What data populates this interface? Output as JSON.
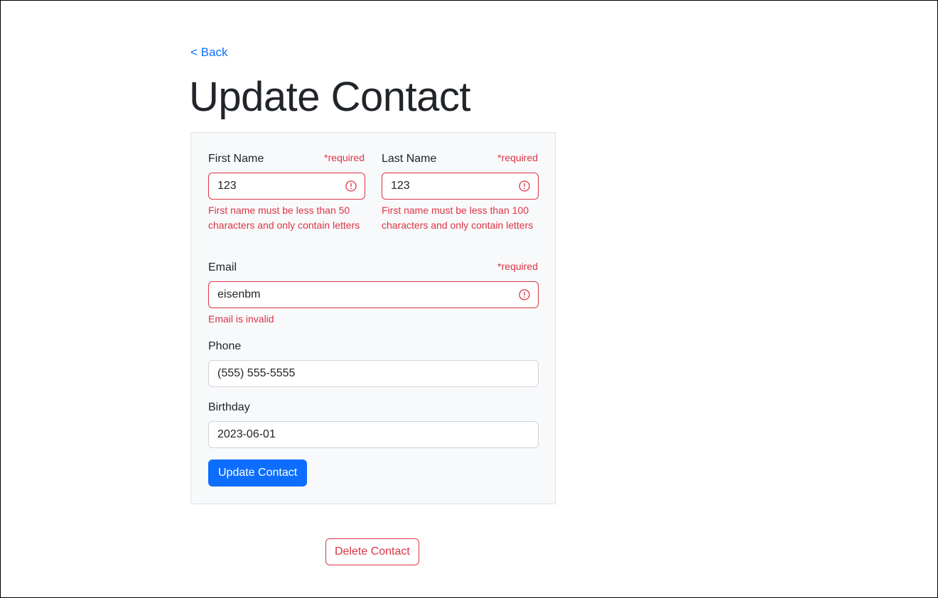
{
  "nav": {
    "back_label": "< Back"
  },
  "page": {
    "title": "Update Contact"
  },
  "form": {
    "required_marker": "*required",
    "first_name": {
      "label": "First Name",
      "value": "123",
      "error": "First name must be less than 50 characters and only contain letters"
    },
    "last_name": {
      "label": "Last Name",
      "value": "123",
      "error": "First name must be less than 100 characters and only contain letters"
    },
    "email": {
      "label": "Email",
      "value": "eisenbm",
      "error": "Email is invalid"
    },
    "phone": {
      "label": "Phone",
      "value": "(555) 555-5555"
    },
    "birthday": {
      "label": "Birthday",
      "value": "2023-06-01"
    },
    "submit_label": "Update Contact"
  },
  "actions": {
    "delete_label": "Delete Contact"
  },
  "colors": {
    "primary": "#0d6efd",
    "danger": "#dc3545",
    "card_background": "#f8f9fa",
    "text": "#212529"
  },
  "icons": {
    "invalid": "exclamation-circle-icon"
  }
}
